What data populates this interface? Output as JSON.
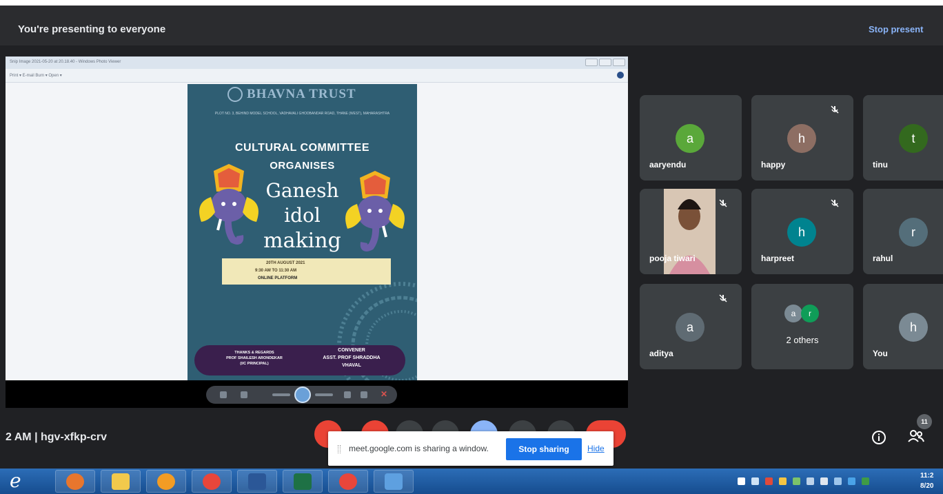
{
  "topbar": {
    "presenting_text": "You're presenting to everyone",
    "stop_presenting_label": "Stop present"
  },
  "viewer": {
    "title": "Snip Image 2021-05-20 at 20.18.40 - Windows Photo Viewer",
    "toolbar": "Print ▾   E-mail   Burn ▾   Open ▾"
  },
  "poster": {
    "trust_name": "BHAVNA TRUST",
    "address": "PLOT NO. 3, BEHIND MODEL SCHOOL, VADHAVALI GHODBANDAR ROAD, THANE (WEST), MAHARASHTRA",
    "cultural_committee": "CULTURAL COMMITTEE",
    "organises": "ORGANISES",
    "script_line1": "Ganesh",
    "script_line2": "idol",
    "script_line3": "making",
    "date": "20TH AUGUST 2021",
    "time": "9:30 AM TO 11:30 AM",
    "platform": "ONLINE PLATFORM",
    "thanks_line1": "THANKS & REGARDS",
    "thanks_line2": "PROF SHAILESH ARONDEKAR",
    "thanks_line3": "(I/C PRINCIPAL)",
    "convener_line1": "CONVENER",
    "convener_line2": "ASST. PROF SHRADDHA",
    "convener_line3": "VHAVAL"
  },
  "participants": [
    {
      "name": "aaryendu",
      "initial": "a",
      "color": "#5aa83a",
      "muted": false
    },
    {
      "name": "happy",
      "initial": "h",
      "color": "#8d6e63",
      "muted": true
    },
    {
      "name": "tinu",
      "initial": "t",
      "color": "#33691e",
      "muted": false
    },
    {
      "name": "pooja tiwari",
      "initial": "",
      "color": "#c9b7a6",
      "muted": true
    },
    {
      "name": "harpreet",
      "initial": "h",
      "color": "#00838f",
      "muted": true
    },
    {
      "name": "rahul",
      "initial": "r",
      "color": "#546e7a",
      "muted": false
    },
    {
      "name": "aditya",
      "initial": "a",
      "color": "#5f6b73",
      "muted": true
    },
    {
      "name": "2 others",
      "initial": "",
      "color": "#3c4043",
      "muted": false
    },
    {
      "name": "You",
      "initial": "h",
      "color": "#7b8a94",
      "muted": false
    }
  ],
  "others": {
    "initials": [
      "a",
      "r"
    ]
  },
  "meeting": {
    "info": "2 AM  |  hgv-xfkp-crv",
    "participant_count": "11"
  },
  "notice": {
    "text": "meet.google.com is sharing a window.",
    "stop_sharing_label": "Stop sharing",
    "hide_label": "Hide"
  },
  "taskbar": {
    "start_glyph": "e",
    "apps": [
      "internet-explorer",
      "firefox",
      "file-explorer",
      "media-player",
      "chrome",
      "word",
      "excel",
      "chrome-meet",
      "photo-viewer"
    ],
    "clock_time": "11:2",
    "clock_date": "8/20"
  }
}
